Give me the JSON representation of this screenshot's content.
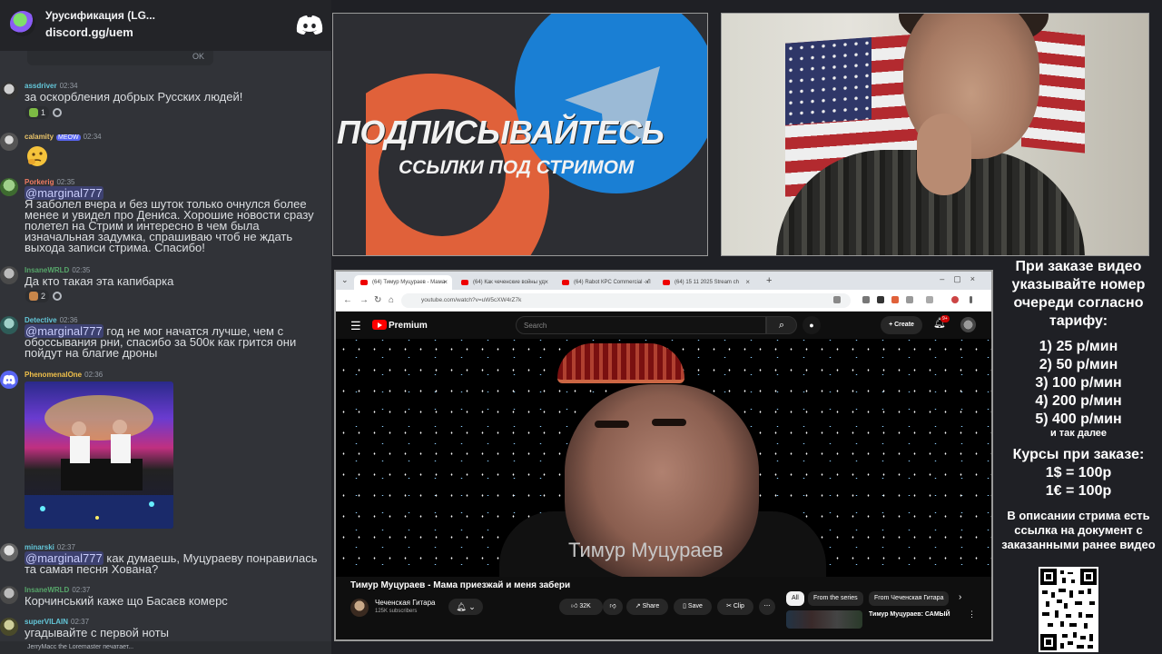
{
  "discord": {
    "server_name": "Урусификация (LG...",
    "invite": "discord.gg/uem",
    "pill_text": "OK",
    "messages": [
      {
        "author": "assdriver",
        "author_color": "#63c6d8",
        "time": "02:34",
        "text": "за оскорбления добрых Русских людей!",
        "reactions": [
          "1"
        ]
      },
      {
        "author": "calamity",
        "author_color": "#e9c46a",
        "tag": "MEOW",
        "time": "02:34"
      },
      {
        "author": "Porkerig",
        "author_color": "#f07b62",
        "time": "02:35",
        "mention": "@marginal777",
        "text": "Я заболел вчера и без шуток только очнулся более менее и увидел про Дениса. Хорошие новости сразу полетел на Стрим и интересно в чем была изначальная задумка, спрашиваю чтоб не ждать выхода записи стрима. Спасибо!"
      },
      {
        "author": "InsaneWRLD",
        "author_color": "#57a66a",
        "time": "02:35",
        "text": "Да кто такая эта капибарка",
        "reactions": [
          "2"
        ]
      },
      {
        "author": "Detective",
        "author_color": "#63c6d8",
        "time": "02:36",
        "mention": "@marginal777",
        "text": "год не мог начатся лучше, чем с обоссывания рни, спасибо за 500к как грится они пойдут на благие дроны"
      },
      {
        "author": "PhenomenalOne",
        "author_color": "#f0c04a",
        "time": "02:36"
      },
      {
        "author": "minarski",
        "author_color": "#63c6d8",
        "time": "02:37",
        "mention": "@marginal777",
        "text": "как думаешь, Муцураеву понравилась та самая песня Хована?"
      },
      {
        "author": "InsaneWRLD",
        "author_color": "#57a66a",
        "time": "02:37",
        "text": "Корчинський каже що Басаєв комерс"
      },
      {
        "author": "superVILAIN",
        "author_color": "#63c6d8",
        "time": "02:37",
        "text": "угадывайте с первой ноты"
      }
    ],
    "footer": "JerryMacc the Loremaster печатает..."
  },
  "banner": {
    "line1": "ПОДПИСЫВАЙТЕСЬ",
    "line2": "ССЫЛКИ ПОД СТРИМОМ"
  },
  "order_panel": {
    "intro": "При заказе видео указывайте номер очереди согласно тарифу:",
    "tariffs": [
      "1) 25 р/мин",
      "2) 50 р/мин",
      "3) 100 р/мин",
      "4) 200 р/мин",
      "5) 400 р/мин"
    ],
    "etc": "и так далее",
    "rates_title": "Курсы при заказе:",
    "rates": [
      "1$ = 100р",
      "1€ = 100р"
    ],
    "desc": "В описании стрима есть ссылка на документ с заказанными ранее видео"
  },
  "browser": {
    "tabs": [
      "(64) Тимур Муцураев - Мама",
      "(64) Как чеченские войны уд",
      "(64) Rabot КРС Commercial - Л",
      "(64) 15 11 2025 Stream ch"
    ],
    "url": "youtube.com/watch?v=uW5cXW4rZ7k"
  },
  "youtube": {
    "brand": "Premium",
    "search_placeholder": "Search",
    "create_label": "Create",
    "notif_count": "9+",
    "video_overlay": "Тимур Муцураев",
    "video_title": "Тимур Муцураев - Мама приезжай и меня забери",
    "channel": "Чеченская Гитара",
    "subscribers": "125K subscribers",
    "likes": "32K",
    "share": "Share",
    "save": "Save",
    "clip": "Clip",
    "chips": [
      "All",
      "From the series",
      "From Чеченская Гитара"
    ],
    "related_title": "Тимур Муцураев: САМЫЙ"
  },
  "colors": {
    "discord_bg": "#313338",
    "youtube_red": "#ff0000",
    "telegram_blue": "#1a7fd4",
    "patreon_orange": "#e0613a"
  }
}
